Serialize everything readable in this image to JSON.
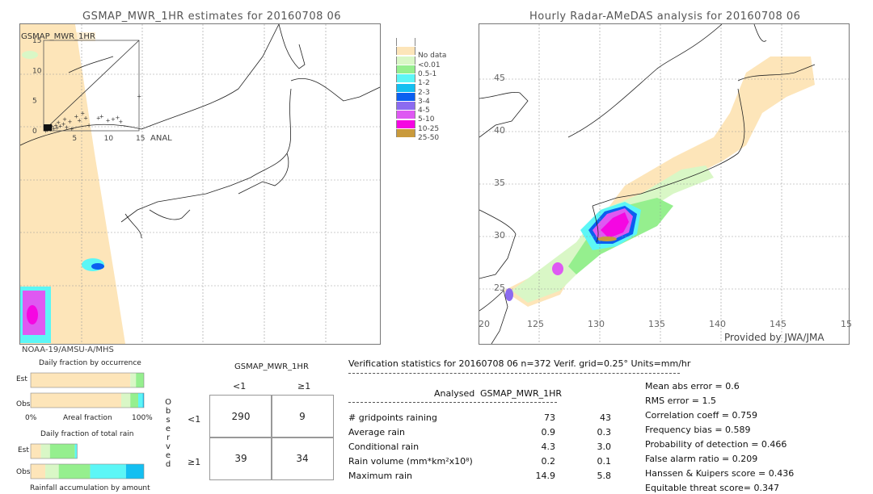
{
  "left_panel": {
    "title": "GSMAP_MWR_1HR estimates for 20160708 06",
    "inset_label": "GSMAP_MWR_1HR",
    "inset_x_label": "ANAL",
    "inset_ticks": [
      "0",
      "5",
      "10",
      "15"
    ],
    "sensor_label": "NOAA-19/AMSU-A/MHS"
  },
  "right_panel": {
    "title": "Hourly Radar-AMeDAS analysis for 20160708 06",
    "lat_ticks": [
      "45",
      "40",
      "35",
      "30",
      "25"
    ],
    "lon_ticks": [
      "20",
      "125",
      "130",
      "135",
      "140",
      "145",
      "15"
    ],
    "credit": "Provided by JWA/JMA"
  },
  "legend": {
    "items": [
      {
        "label": "",
        "color": "#ffffff"
      },
      {
        "label": "No data",
        "color": "#fde5b9"
      },
      {
        "label": "<0.01",
        "color": "#d9f7c6"
      },
      {
        "label": "0.5-1",
        "color": "#95ef8e"
      },
      {
        "label": "1-2",
        "color": "#5cf6f6"
      },
      {
        "label": "2-3",
        "color": "#14bff1"
      },
      {
        "label": "3-4",
        "color": "#0b5ff0"
      },
      {
        "label": "4-5",
        "color": "#8c6bf0"
      },
      {
        "label": "5-10",
        "color": "#de59f2"
      },
      {
        "label": "10-25",
        "color": "#f507e2"
      },
      {
        "label": "25-50",
        "color": "#c99a3c"
      }
    ]
  },
  "fraction_charts": {
    "occurrence_title": "Daily fraction by occurrence",
    "est_label": "Est",
    "obs_label": "Obs",
    "axis_left": "0%",
    "axis_mid": "Areal fraction",
    "axis_right": "100%",
    "total_rain_title": "Daily fraction of total rain",
    "accum_title": "Rainfall accumulation by amount"
  },
  "contingency": {
    "title": "GSMAP_MWR_1HR",
    "col_labels": [
      "<1",
      "≥1"
    ],
    "row_labels": [
      "<1",
      "≥1"
    ],
    "observed_label": [
      "O",
      "b",
      "s",
      "e",
      "r",
      "v",
      "e",
      "d"
    ],
    "cells": [
      [
        "290",
        "9"
      ],
      [
        "39",
        "34"
      ]
    ]
  },
  "verification": {
    "header": "Verification statistics for 20160708 06   n=372   Verif. grid=0.25°   Units=mm/hr",
    "col_analysed": "Analysed",
    "col_model": "GSMAP_MWR_1HR",
    "rows": [
      {
        "label": "# gridpoints raining",
        "analysed": "73",
        "model": "43"
      },
      {
        "label": "Average rain",
        "analysed": "0.9",
        "model": "0.3"
      },
      {
        "label": "Conditional rain",
        "analysed": "4.3",
        "model": "3.0"
      },
      {
        "label": "Rain volume (mm*km²x10⁸)",
        "analysed": "0.2",
        "model": "0.1"
      },
      {
        "label": "Maximum rain",
        "analysed": "14.9",
        "model": "5.8"
      }
    ],
    "scores": [
      "Mean abs error = 0.6",
      "RMS error = 1.5",
      "Correlation coeff = 0.759",
      "Frequency bias = 0.589",
      "Probability of detection = 0.466",
      "False alarm ratio = 0.209",
      "Hanssen & Kuipers score = 0.436",
      "Equitable threat score= 0.347"
    ]
  },
  "chart_data": [
    {
      "type": "bar",
      "title": "Daily fraction by occurrence",
      "xlabel": "Areal fraction",
      "categories": [
        "Est",
        "Obs"
      ],
      "stacked": true,
      "xlim": [
        0,
        100
      ],
      "series": [
        {
          "name": "No data",
          "color": "#fde5b9",
          "values": [
            88,
            80
          ]
        },
        {
          "name": "<0.01",
          "color": "#d9f7c6",
          "values": [
            5,
            8
          ]
        },
        {
          "name": "0.5-1",
          "color": "#95ef8e",
          "values": [
            7,
            7
          ]
        },
        {
          "name": "1-2",
          "color": "#5cf6f6",
          "values": [
            0,
            4
          ]
        },
        {
          "name": "2-3",
          "color": "#14bff1",
          "values": [
            0,
            1
          ]
        }
      ]
    },
    {
      "type": "bar",
      "title": "Daily fraction of total rain",
      "xlabel": "Rainfall accumulation by amount",
      "categories": [
        "Est",
        "Obs"
      ],
      "stacked": true,
      "series": [
        {
          "name": "No data",
          "color": "#fde5b9",
          "values": [
            9,
            13
          ]
        },
        {
          "name": "<0.01",
          "color": "#d9f7c6",
          "values": [
            8,
            12
          ]
        },
        {
          "name": "0.5-1",
          "color": "#95ef8e",
          "values": [
            22,
            28
          ]
        },
        {
          "name": "1-2",
          "color": "#5cf6f6",
          "values": [
            2,
            32
          ]
        },
        {
          "name": "2-3",
          "color": "#14bff1",
          "values": [
            0,
            16
          ]
        }
      ],
      "est_total_fraction": 0.41
    },
    {
      "type": "scatter",
      "title": "GSMAP_MWR_1HR vs ANAL",
      "xlabel": "ANAL",
      "ylabel": "GSMAP_MWR_1HR",
      "xlim": [
        0,
        15
      ],
      "ylim": [
        0,
        15
      ],
      "points": [
        [
          0.2,
          0.1
        ],
        [
          0.5,
          0.2
        ],
        [
          0.8,
          0.4
        ],
        [
          1.0,
          0.3
        ],
        [
          1.2,
          0.8
        ],
        [
          1.5,
          0.5
        ],
        [
          1.8,
          1.0
        ],
        [
          2.0,
          0.6
        ],
        [
          2.2,
          1.5
        ],
        [
          2.5,
          0.9
        ],
        [
          3.0,
          1.2
        ],
        [
          3.2,
          2.0
        ],
        [
          3.5,
          0.7
        ],
        [
          4.0,
          1.6
        ],
        [
          4.3,
          0.4
        ],
        [
          5.0,
          2.5
        ],
        [
          5.5,
          1.8
        ],
        [
          6.0,
          3.0
        ],
        [
          6.5,
          2.2
        ],
        [
          7.0,
          1.0
        ],
        [
          8.5,
          2.2
        ],
        [
          9.0,
          2.5
        ],
        [
          10.0,
          1.8
        ],
        [
          10.8,
          2.0
        ],
        [
          11.5,
          2.3
        ],
        [
          12.0,
          1.6
        ],
        [
          14.9,
          5.8
        ]
      ]
    }
  ]
}
